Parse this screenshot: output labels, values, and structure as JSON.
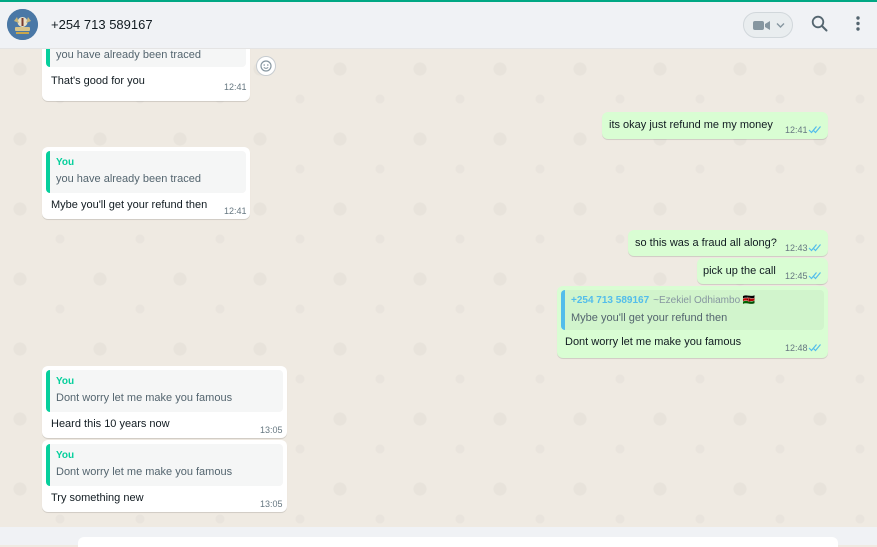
{
  "header": {
    "title": "+254 713 589167",
    "icons": [
      "video-call-icon",
      "chevron-down-icon",
      "search-icon",
      "menu-icon"
    ]
  },
  "colors": {
    "accent": "#00a884",
    "incoming_bg": "#ffffff",
    "outgoing_bg": "#d9fdd3",
    "quote_bar_in": "#06cf9c",
    "quote_bar_out": "#53bdeb",
    "read_tick": "#53bdeb"
  },
  "messages": [
    {
      "direction": "in",
      "quote_text": "you have already been traced",
      "text": "That's good for you",
      "time": "12:41"
    },
    {
      "direction": "out",
      "text": "its okay just refund me my money",
      "time": "12:41",
      "status": "read"
    },
    {
      "direction": "in",
      "quote_name": "You",
      "quote_text": "you have already been traced",
      "text": "Mybe you'll get your refund then",
      "time": "12:41"
    },
    {
      "direction": "out",
      "text": "so this was a fraud all along?",
      "time": "12:43",
      "status": "read"
    },
    {
      "direction": "out",
      "text": "pick up the call",
      "time": "12:45",
      "status": "read"
    },
    {
      "direction": "out",
      "quote_name": "+254 713 589167",
      "quote_alias": "~Ezekiel Odhiambo",
      "quote_flag": "🇰🇪",
      "quote_text": "Mybe you'll get your refund then",
      "text": "Dont worry let me  make you famous",
      "time": "12:48",
      "status": "read"
    },
    {
      "direction": "in",
      "quote_name": "You",
      "quote_text": "Dont worry let me  make you famous",
      "text": "Heard this 10 years now",
      "time": "13:05"
    },
    {
      "direction": "in",
      "quote_name": "You",
      "quote_text": "Dont worry let me  make you famous",
      "text": "Try something new",
      "time": "13:05"
    }
  ]
}
